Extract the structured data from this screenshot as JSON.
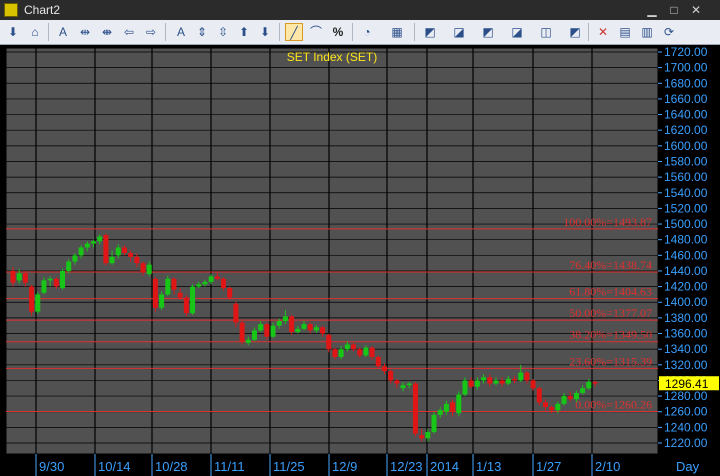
{
  "window": {
    "title": "Chart2"
  },
  "toolbar": {
    "percent_label": "%",
    "tools": [
      "pin-icon",
      "home-icon",
      "text-tool-icon",
      "expand-h-icon",
      "compress-h-icon",
      "arrow-left-icon",
      "arrow-right-icon",
      "font-icon",
      "expand-v-icon",
      "compress-v-icon",
      "arrow-up-icon",
      "arrow-down-icon",
      "line-tool-icon",
      "curve-tool-icon",
      "percent-icon",
      "cursor-icon",
      "panel-icon",
      "chart-1-icon",
      "chart-2-icon",
      "chart-3-icon",
      "chart-4-icon",
      "chart-5-icon",
      "chart-6-icon",
      "delete-icon",
      "save-icon",
      "export-icon",
      "refresh-icon"
    ]
  },
  "chart_data": {
    "type": "candlestick",
    "title": "SET Index (SET)",
    "colors": {
      "up": "#17c617",
      "down": "#e01616",
      "fib": "#e03030",
      "price_box": "#ffff00",
      "background": "#515151",
      "grid": "#000000"
    },
    "y_axis": {
      "min": 1220,
      "max": 1720,
      "step": 20,
      "ticks": [
        "1720.00",
        "1700.00",
        "1680.00",
        "1660.00",
        "1640.00",
        "1620.00",
        "1600.00",
        "1580.00",
        "1560.00",
        "1540.00",
        "1520.00",
        "1500.00",
        "1480.00",
        "1460.00",
        "1440.00",
        "1420.00",
        "1400.00",
        "1380.00",
        "1360.00",
        "1340.00",
        "1320.00",
        "1300.00",
        "1280.00",
        "1260.00",
        "1240.00",
        "1220.00"
      ]
    },
    "x_axis": {
      "labels": [
        "9/30",
        "10/14",
        "10/28",
        "11/11",
        "11/25",
        "12/9",
        "12/23",
        "2014",
        "1/13",
        "1/27",
        "2/10"
      ],
      "period_label": "Day"
    },
    "last_price": "1296.41",
    "fib_levels": [
      {
        "value": 1493.87,
        "label": "100.00%=1493.87"
      },
      {
        "value": 1438.74,
        "label": "76.40%=1438.74"
      },
      {
        "value": 1404.63,
        "label": "61.80%=1404.63"
      },
      {
        "value": 1377.07,
        "label": "50.00%=1377.07"
      },
      {
        "value": 1349.5,
        "label": "38.20%=1349.50"
      },
      {
        "value": 1315.39,
        "label": "23.60%=1315.39"
      },
      {
        "value": 1260.26,
        "label": "0.00%=1260.26"
      }
    ],
    "candles": [
      [
        1440,
        1425,
        1445,
        1420
      ],
      [
        1428,
        1437,
        1442,
        1424
      ],
      [
        1437,
        1425,
        1440,
        1420
      ],
      [
        1420,
        1388,
        1422,
        1383
      ],
      [
        1388,
        1410,
        1413,
        1385
      ],
      [
        1412,
        1428,
        1432,
        1410
      ],
      [
        1428,
        1430,
        1433,
        1420
      ],
      [
        1430,
        1420,
        1432,
        1417
      ],
      [
        1418,
        1440,
        1443,
        1416
      ],
      [
        1440,
        1452,
        1455,
        1437
      ],
      [
        1452,
        1460,
        1463,
        1448
      ],
      [
        1460,
        1470,
        1473,
        1456
      ],
      [
        1470,
        1475,
        1478,
        1465
      ],
      [
        1475,
        1478,
        1480,
        1470
      ],
      [
        1478,
        1484,
        1487,
        1474
      ],
      [
        1486,
        1450,
        1488,
        1447
      ],
      [
        1450,
        1458,
        1466,
        1448
      ],
      [
        1460,
        1470,
        1474,
        1456
      ],
      [
        1470,
        1463,
        1473,
        1460
      ],
      [
        1463,
        1458,
        1466,
        1452
      ],
      [
        1458,
        1450,
        1462,
        1445
      ],
      [
        1450,
        1438,
        1452,
        1434
      ],
      [
        1436,
        1448,
        1452,
        1433
      ],
      [
        1430,
        1393,
        1432,
        1388
      ],
      [
        1393,
        1410,
        1414,
        1390
      ],
      [
        1410,
        1430,
        1434,
        1408
      ],
      [
        1430,
        1416,
        1432,
        1410
      ],
      [
        1412,
        1406,
        1418,
        1403
      ],
      [
        1406,
        1386,
        1409,
        1382
      ],
      [
        1386,
        1420,
        1423,
        1384
      ],
      [
        1420,
        1423,
        1426,
        1418
      ],
      [
        1423,
        1426,
        1429,
        1420
      ],
      [
        1426,
        1433,
        1436,
        1423
      ],
      [
        1433,
        1430,
        1438,
        1428
      ],
      [
        1430,
        1418,
        1432,
        1415
      ],
      [
        1418,
        1406,
        1420,
        1403
      ],
      [
        1398,
        1374,
        1401,
        1368
      ],
      [
        1374,
        1350,
        1376,
        1346
      ],
      [
        1348,
        1352,
        1356,
        1345
      ],
      [
        1352,
        1364,
        1368,
        1350
      ],
      [
        1364,
        1372,
        1376,
        1362
      ],
      [
        1372,
        1356,
        1374,
        1352
      ],
      [
        1356,
        1370,
        1374,
        1354
      ],
      [
        1370,
        1376,
        1379,
        1366
      ],
      [
        1376,
        1382,
        1390,
        1372
      ],
      [
        1382,
        1362,
        1384,
        1358
      ],
      [
        1362,
        1366,
        1370,
        1360
      ],
      [
        1366,
        1372,
        1376,
        1364
      ],
      [
        1372,
        1364,
        1374,
        1360
      ],
      [
        1364,
        1368,
        1371,
        1361
      ],
      [
        1368,
        1360,
        1370,
        1356
      ],
      [
        1358,
        1340,
        1360,
        1336
      ],
      [
        1340,
        1330,
        1342,
        1327
      ],
      [
        1330,
        1340,
        1344,
        1327
      ],
      [
        1340,
        1346,
        1350,
        1337
      ],
      [
        1346,
        1340,
        1348,
        1337
      ],
      [
        1340,
        1332,
        1342,
        1329
      ],
      [
        1332,
        1342,
        1345,
        1330
      ],
      [
        1342,
        1330,
        1344,
        1326
      ],
      [
        1330,
        1318,
        1332,
        1316
      ],
      [
        1318,
        1312,
        1322,
        1308
      ],
      [
        1312,
        1300,
        1314,
        1296
      ],
      [
        1300,
        1296,
        1302,
        1290
      ],
      [
        1290,
        1294,
        1298,
        1286
      ],
      [
        1294,
        1296,
        1298,
        1290
      ],
      [
        1296,
        1232,
        1298,
        1228
      ],
      [
        1230,
        1226,
        1238,
        1222
      ],
      [
        1226,
        1234,
        1238,
        1222
      ],
      [
        1234,
        1256,
        1260,
        1232
      ],
      [
        1256,
        1262,
        1266,
        1252
      ],
      [
        1260,
        1270,
        1274,
        1256
      ],
      [
        1272,
        1260,
        1276,
        1254
      ],
      [
        1258,
        1282,
        1286,
        1254
      ],
      [
        1282,
        1300,
        1304,
        1280
      ],
      [
        1300,
        1292,
        1304,
        1290
      ],
      [
        1292,
        1300,
        1304,
        1288
      ],
      [
        1300,
        1304,
        1308,
        1296
      ],
      [
        1304,
        1296,
        1308,
        1292
      ],
      [
        1296,
        1300,
        1304,
        1294
      ],
      [
        1300,
        1296,
        1304,
        1292
      ],
      [
        1296,
        1302,
        1306,
        1294
      ],
      [
        1302,
        1300,
        1306,
        1296
      ],
      [
        1300,
        1310,
        1320,
        1298
      ],
      [
        1310,
        1300,
        1312,
        1296
      ],
      [
        1300,
        1290,
        1302,
        1287
      ],
      [
        1290,
        1272,
        1292,
        1268
      ],
      [
        1272,
        1266,
        1276,
        1262
      ],
      [
        1266,
        1262,
        1268,
        1258
      ],
      [
        1262,
        1270,
        1273,
        1258
      ],
      [
        1270,
        1280,
        1284,
        1268
      ],
      [
        1280,
        1276,
        1286,
        1273
      ],
      [
        1276,
        1284,
        1287,
        1272
      ],
      [
        1284,
        1290,
        1294,
        1282
      ],
      [
        1290,
        1298,
        1302,
        1288
      ],
      [
        1298,
        1296,
        1300,
        1292
      ]
    ]
  }
}
